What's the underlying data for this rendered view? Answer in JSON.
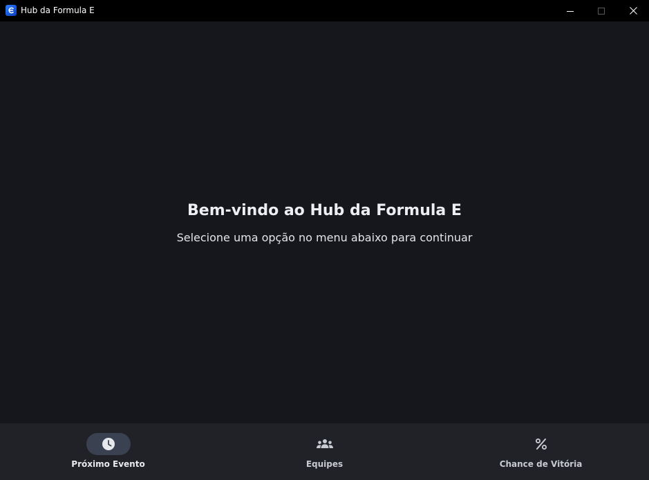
{
  "window": {
    "title": "Hub da Formula E",
    "controls": {
      "minimize_icon": "minimize-icon",
      "maximize_icon": "maximize-icon",
      "close_icon": "close-icon"
    }
  },
  "main": {
    "title": "Bem-vindo ao Hub da Formula E",
    "subtitle": "Selecione uma opção no menu abaixo para continuar"
  },
  "bottom_nav": {
    "selected_index": 0,
    "items": [
      {
        "label": "Próximo Evento",
        "icon": "clock-icon"
      },
      {
        "label": "Equipes",
        "icon": "groups-icon"
      },
      {
        "label": "Chance de Vitória",
        "icon": "percent-icon"
      }
    ]
  },
  "colors": {
    "background": "#16171d",
    "titlebar": "#000000",
    "nav_background": "#202228",
    "active_pill": "#3a4150",
    "app_icon": "#1f6bff"
  }
}
